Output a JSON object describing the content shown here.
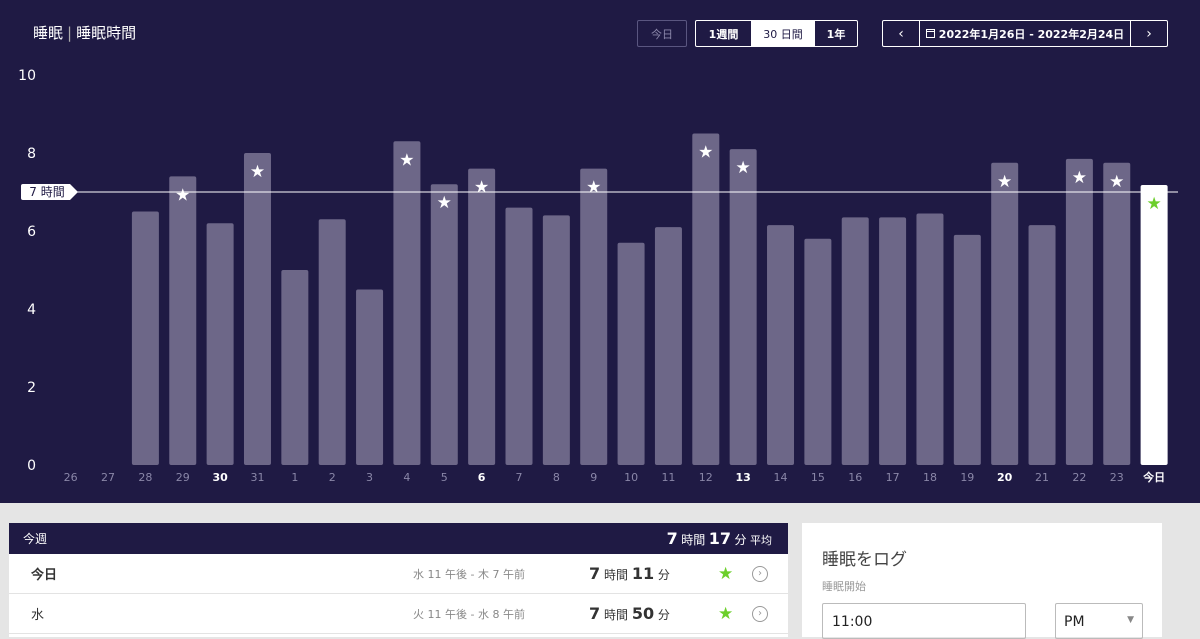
{
  "header": {
    "title_main": "睡眠",
    "title_sep": "|",
    "title_sub": "睡眠時間",
    "today_button": "今日",
    "ranges": [
      "1週間",
      "30 日間",
      "1年"
    ],
    "selected_range": "30 日間",
    "date_range": "2022年1月26日 - 2022年2月24日",
    "prev_icon": "chevron-left-icon",
    "next_icon": "chevron-right-icon"
  },
  "chart_data": {
    "type": "bar",
    "categories": [
      "26",
      "27",
      "28",
      "29",
      "30",
      "31",
      "1",
      "2",
      "3",
      "4",
      "5",
      "6",
      "7",
      "8",
      "9",
      "10",
      "11",
      "12",
      "13",
      "14",
      "15",
      "16",
      "17",
      "18",
      "19",
      "20",
      "21",
      "22",
      "23",
      "今日"
    ],
    "bold_categories": [
      "30",
      "6",
      "13",
      "20",
      "今日"
    ],
    "values": [
      null,
      null,
      6.5,
      7.4,
      6.2,
      8.0,
      5.0,
      6.3,
      4.5,
      8.3,
      7.2,
      7.6,
      6.6,
      6.4,
      7.6,
      5.7,
      6.1,
      8.5,
      8.1,
      6.15,
      5.8,
      6.35,
      6.35,
      6.45,
      5.9,
      7.75,
      6.15,
      7.85,
      7.75,
      7.18
    ],
    "star_goal_met": [
      false,
      false,
      false,
      true,
      false,
      true,
      false,
      false,
      false,
      true,
      true,
      true,
      false,
      false,
      true,
      false,
      false,
      true,
      true,
      false,
      false,
      false,
      false,
      false,
      false,
      true,
      false,
      true,
      true,
      true
    ],
    "highlight_index": 29,
    "y_ticks": [
      "0",
      "2",
      "4",
      "6",
      "8",
      "10"
    ],
    "ylim": [
      0,
      10
    ],
    "goal_line": {
      "value": 7,
      "label": "7 時間"
    },
    "colors": {
      "bar": "#6d6788",
      "today_bar": "#ffffff",
      "star": "#ffffff",
      "today_star": "#6ccf2b",
      "background": "#1f1a44",
      "goal_line": "#ffffff"
    }
  },
  "week": {
    "title": "今週",
    "avg_hours": "7",
    "avg_hours_unit": "時間",
    "avg_minutes": "17",
    "avg_minutes_unit": "分",
    "avg_label": "平均",
    "rows": [
      {
        "day": "今日",
        "range": "水 11 午後 - 木 7 午前",
        "hours": "7",
        "hours_unit": "時間",
        "minutes": "11",
        "minutes_unit": "分"
      },
      {
        "day": "水",
        "range": "火 11 午後 - 水 8 午前",
        "hours": "7",
        "hours_unit": "時間",
        "minutes": "50",
        "minutes_unit": "分"
      }
    ]
  },
  "log": {
    "title": "睡眠をログ",
    "start_label": "睡眠開始",
    "start_time": "11:00",
    "ampm": "PM"
  }
}
